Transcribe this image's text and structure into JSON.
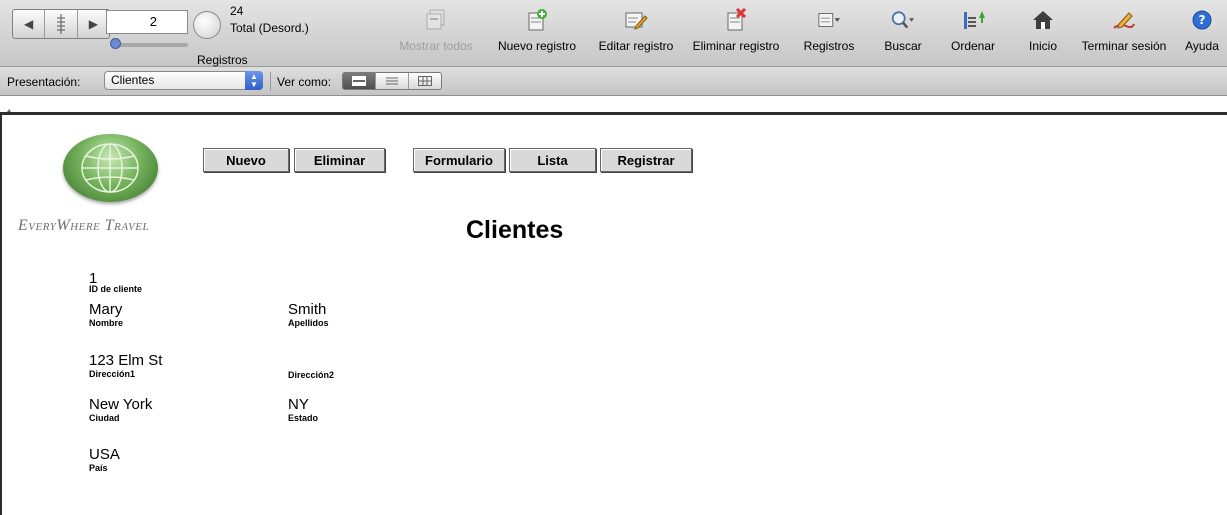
{
  "toolbar": {
    "record_number": "2",
    "record_progress": 0.083,
    "total_count": "24",
    "total_state": "Total (Desord.)",
    "records_label": "Registros",
    "buttons": {
      "show_all": "Mostrar todos",
      "new_record": "Nuevo registro",
      "edit_record": "Editar registro",
      "delete_record": "Eliminar registro",
      "records": "Registros",
      "find": "Buscar",
      "sort": "Ordenar",
      "home": "Inicio",
      "logout": "Terminar sesión",
      "help": "Ayuda"
    },
    "icons": {
      "show_all": "show-all-icon",
      "new_record": "new-record-icon",
      "edit_record": "edit-record-icon",
      "delete_record": "delete-record-icon",
      "records": "records-menu-icon",
      "find": "magnifier-icon",
      "sort": "sort-icon",
      "home": "home-icon",
      "logout": "pen-logout-icon",
      "help": "question-icon"
    }
  },
  "layoutbar": {
    "layout_label": "Presentación:",
    "layout_value": "Clientes",
    "view_label": "Ver como:",
    "view_modes": [
      "form",
      "list",
      "table"
    ]
  },
  "layout": {
    "logo_text": "EveryWhere Travel",
    "buttons": {
      "new": "Nuevo",
      "delete": "Eliminar",
      "form": "Formulario",
      "list": "Lista",
      "register": "Registrar"
    },
    "title": "Clientes",
    "fields": {
      "customer_id": {
        "value": "1",
        "label": "ID de cliente"
      },
      "first_name": {
        "value": "Mary",
        "label": "Nombre"
      },
      "last_name": {
        "value": "Smith",
        "label": "Apellidos"
      },
      "address1": {
        "value": "123 Elm St",
        "label": "Dirección1"
      },
      "address2": {
        "value": "",
        "label": "Dirección2"
      },
      "city": {
        "value": "New York",
        "label": "Ciudad"
      },
      "state": {
        "value": "NY",
        "label": "Estado"
      },
      "country": {
        "value": "USA",
        "label": "País"
      }
    }
  },
  "colors": {
    "accent_blue": "#2f5fc9",
    "globe_green": "#5a9a45",
    "logo_gray": "#6f6f6f"
  }
}
